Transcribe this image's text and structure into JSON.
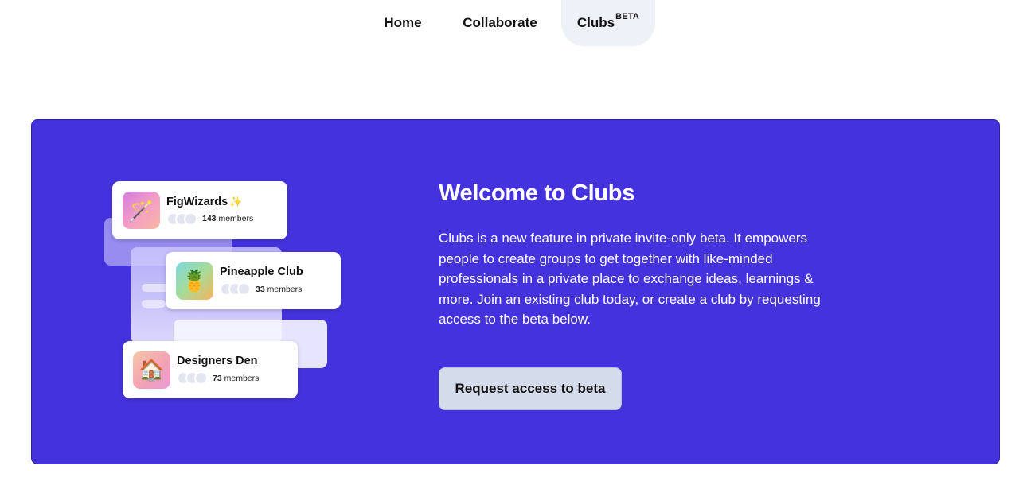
{
  "nav": {
    "home": "Home",
    "collaborate": "Collaborate",
    "clubs": "Clubs",
    "clubs_badge": "BETA"
  },
  "hero": {
    "title": "Welcome to Clubs",
    "description": "Clubs is a new feature in private invite-only beta. It empowers people to create groups to get together with like-minded professionals in a private place to exchange ideas, learnings & more. Join an existing club today, or create a club by requesting access to the beta below.",
    "cta": "Request access to beta",
    "background_color": "#4433dc"
  },
  "clubs": [
    {
      "name": "FigWizards",
      "name_suffix": "✨",
      "count": "143",
      "count_label": "members",
      "icon": "magic-wand-icon",
      "emoji": "🪄"
    },
    {
      "name": "Pineapple Club",
      "count": "33",
      "count_label": "members",
      "icon": "pineapple-icon",
      "emoji": "🍍"
    },
    {
      "name": "Designers Den",
      "count": "73",
      "count_label": "members",
      "icon": "house-icon",
      "emoji": "🏠"
    }
  ]
}
